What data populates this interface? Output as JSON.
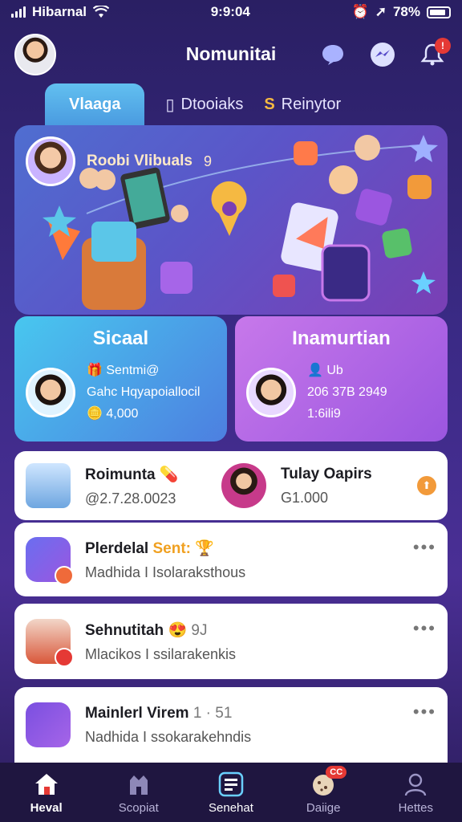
{
  "status_bar": {
    "carrier": "Hibarnal",
    "time": "9:9:04",
    "battery": "78%"
  },
  "header": {
    "title": "Nomunitai"
  },
  "tabs": [
    {
      "label": "Vlaaga",
      "active": true
    },
    {
      "label": "Dtooiaks",
      "active": false
    },
    {
      "label": "Reinytor",
      "active": false
    }
  ],
  "hero": {
    "title": "Roobi Vlibuals",
    "count": "9"
  },
  "cards": [
    {
      "title": "Sicaal",
      "lines": [
        "Sentmi@",
        "Gahc Hqyapoiallocil",
        "4,000"
      ],
      "color": "#48c7ef"
    },
    {
      "title": "Inamurtian",
      "lines": [
        "Ub",
        "206 37B 2949",
        "1:6ili9"
      ],
      "color": "#c778ea"
    }
  ],
  "top_row": {
    "left": {
      "name": "Roimunta",
      "sub": "@2.7.28.0023"
    },
    "right": {
      "name": "Tulay Oapirs",
      "sub": "G1.000"
    }
  },
  "list": [
    {
      "title": "Plerdelal",
      "accent": "Sent:",
      "sub": "Madhida I Isolaraksthous"
    },
    {
      "title": "Sehnutitah",
      "accent": "9J",
      "sub": "Mlacikos I ssilarakenkis"
    },
    {
      "title": "Mainlerl Virem",
      "accent": "1 · 51",
      "sub": "Nadhida I ssokarakehndis"
    }
  ],
  "bottom_nav": [
    {
      "label": "Heval",
      "active": true
    },
    {
      "label": "Scopiat",
      "active": false
    },
    {
      "label": "Senehat",
      "active": false
    },
    {
      "label": "Daiige",
      "active": false,
      "badge": "CC"
    },
    {
      "label": "Hettes",
      "active": false
    }
  ]
}
